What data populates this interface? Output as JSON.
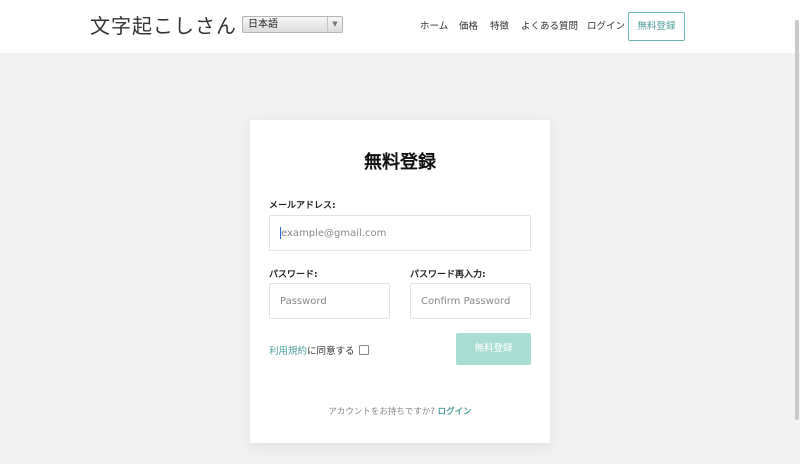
{
  "header": {
    "logo": "文字起こしさん",
    "language_selected": "日本語",
    "nav": {
      "home": "ホーム",
      "pricing": "価格",
      "features": "特徴",
      "faq": "よくある質問",
      "login": "ログイン",
      "signup": "無料登録"
    }
  },
  "form": {
    "title": "無料登録",
    "email_label": "メールアドレス:",
    "email_placeholder": "example@gmail.com",
    "password_label": "パスワード:",
    "password_placeholder": "Password",
    "confirm_label": "パスワード再入力:",
    "confirm_placeholder": "Confirm Password",
    "terms_link": "利用規約",
    "terms_text": "に同意する",
    "terms_checked": false,
    "submit_label": "無料登録",
    "footer_prompt": "アカウントをお持ちですか?",
    "footer_login": "ログイン"
  },
  "colors": {
    "accent": "#4e9f9c",
    "button_disabled": "#a9dcd3",
    "page_background": "#f2f2f2"
  }
}
